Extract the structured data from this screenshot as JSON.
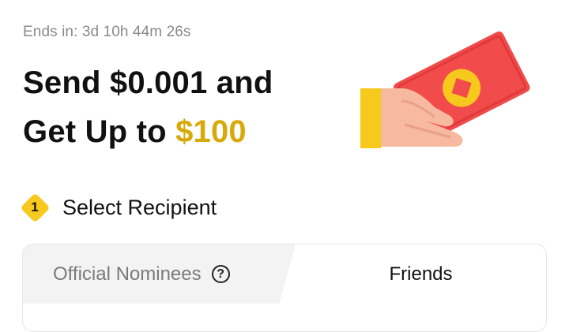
{
  "countdown": "Ends in: 3d 10h 44m 26s",
  "headline": {
    "line1": "Send $0.001 and",
    "line2_prefix": "Get Up to ",
    "line2_amount": "$100"
  },
  "illustration": {
    "icon": "hand-red-envelope-icon"
  },
  "step": {
    "number": "1",
    "title": "Select Recipient"
  },
  "tabs": {
    "official_label": "Official Nominees",
    "help_icon": "question-circle-icon",
    "help_glyph": "?",
    "friends_label": "Friends"
  },
  "colors": {
    "accent": "#d9a90c",
    "badge": "#f7c91c",
    "envelope": "#f24b4b"
  }
}
